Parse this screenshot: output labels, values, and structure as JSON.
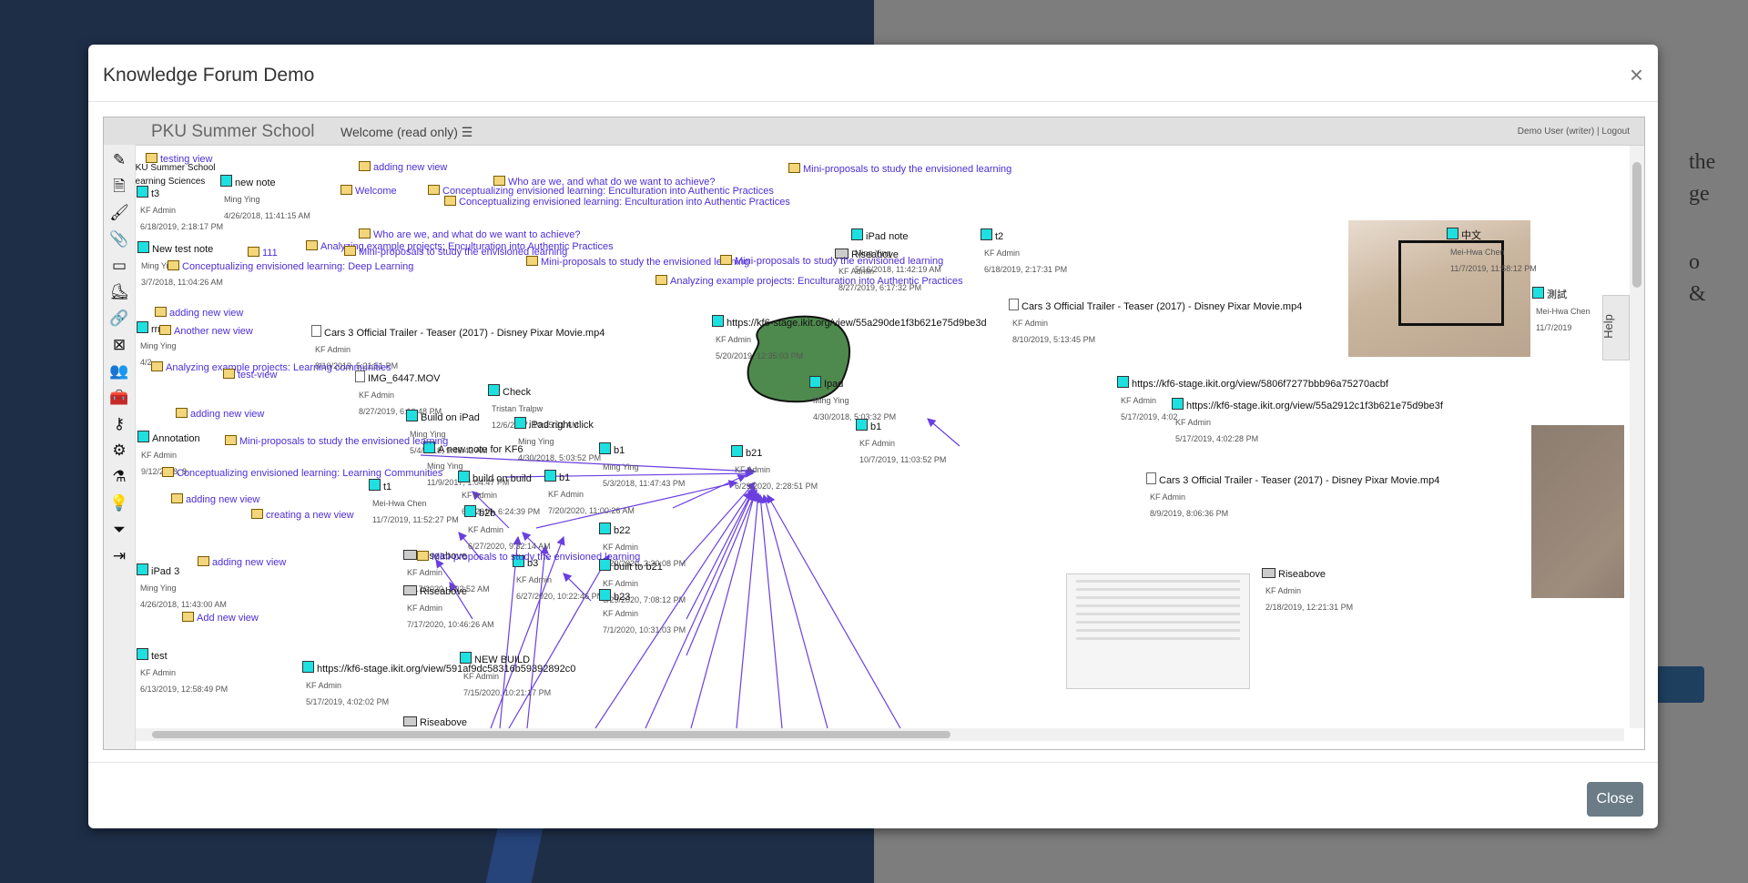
{
  "background": {
    "text_lines": [
      "the",
      "ge",
      "o",
      "&"
    ],
    "colors": {
      "left": "#1e2e47",
      "right": "#7d7d7d"
    }
  },
  "modal": {
    "title": "Knowledge Forum Demo",
    "close_x": "×",
    "close_button": "Close"
  },
  "kf": {
    "community": "PKU Summer School",
    "view_title": "Welcome (read only)",
    "view_menu_icon": "list-icon",
    "user": "Demo User (writer)",
    "separator": "|",
    "logout": "Logout",
    "help": "Help",
    "toolbar": [
      "pencil-icon",
      "note-icon",
      "brush-icon",
      "paperclip-icon",
      "window-icon",
      "shoe-icon",
      "link-icon",
      "image-icon",
      "users-icon",
      "toolbox-icon",
      "key-icon",
      "gear-icon",
      "flask-icon",
      "lightbulb-icon",
      "filter-icon",
      "exit-icon"
    ],
    "link_color": "#4d2ed6",
    "notes": [
      {
        "title": "t3",
        "author": "KF Admin",
        "date": "6/18/2019, 2:18:17 PM"
      },
      {
        "title": "new note",
        "author": "Ming Ying",
        "date": "4/26/2018, 11:41:15 AM"
      },
      {
        "title": "New test note",
        "author": "Ming Ying",
        "date": "3/7/2018, 11:04:26 AM"
      },
      {
        "title": "rrr",
        "author": "Ming Ying",
        "date": "4/2"
      },
      {
        "title": "Cars 3 Official Trailer - Teaser (2017) - Disney Pixar Movie.mp4",
        "author": "KF Admin",
        "date": "8/10/2019, 5:21:51 PM"
      },
      {
        "title": "IMG_6447.MOV",
        "author": "KF Admin",
        "date": "8/27/2019, 6:16:48 PM"
      },
      {
        "title": "Check",
        "author": "Tristan Tralpw",
        "date": "12/6/2017, 10:25:31 AM"
      },
      {
        "title": "Build on iPad",
        "author": "Ming Ying",
        "date": "5/4/2018, 9:46:42 AM"
      },
      {
        "title": "iPad right click",
        "author": "Ming Ying",
        "date": "4/30/2018, 5:03:52 PM"
      },
      {
        "title": "A new note for KF6",
        "author": "Ming Ying",
        "date": "11/9/2017, 1:04:47 PM"
      },
      {
        "title": "b1",
        "author": "Ming Ying",
        "date": "5/3/2018, 11:47:43 PM"
      },
      {
        "title": "Annotation",
        "author": "KF Admin",
        "date": "9/12/2018, 8"
      },
      {
        "title": "t1",
        "author": "Mei-Hwa Chen",
        "date": "11/7/2019, 11:52:27 PM"
      },
      {
        "title": "build on build",
        "author": "KF Admin",
        "date": "6/5/2019, 6:24:39 PM"
      },
      {
        "title": "b1",
        "author": "KF Admin",
        "date": "7/20/2020, 11:00:26 AM"
      },
      {
        "title": "b21",
        "author": "KF Admin",
        "date": "6/29/2020, 2:28:51 PM"
      },
      {
        "title": "b2b",
        "author": "KF Admin",
        "date": "6/27/2020, 9:32:14 AM"
      },
      {
        "title": "b22",
        "author": "KF Admin",
        "date": "6/29/2020, 2:30:08 PM"
      },
      {
        "title": "Riseabove",
        "author": "KF Admin",
        "date": "7/17/2020, 1:02:52 AM"
      },
      {
        "title": "b3",
        "author": "KF Admin",
        "date": "6/27/2020, 10:22:46 PM"
      },
      {
        "title": "built to b21",
        "author": "KF Admin",
        "date": "6/29/2020, 7:08:12 PM"
      },
      {
        "title": "iPad 3",
        "author": "Ming Ying",
        "date": "4/26/2018, 11:43:00 AM"
      },
      {
        "title": "Riseabove",
        "author": "KF Admin",
        "date": "7/17/2020, 10:46:26 AM"
      },
      {
        "title": "b23",
        "author": "KF Admin",
        "date": "7/1/2020, 10:31:03 PM"
      },
      {
        "title": "test",
        "author": "KF Admin",
        "date": "6/13/2019, 12:58:49 PM"
      },
      {
        "title": "https://kf6-stage.ikit.org/view/591af9dc58316b59392892c0",
        "author": "KF Admin",
        "date": "5/17/2019, 4:02:02 PM"
      },
      {
        "title": "NEW BUILD",
        "author": "KF Admin",
        "date": "7/15/2020, 10:21:17 PM"
      },
      {
        "title": "Riseabove",
        "author": "",
        "date": ""
      },
      {
        "title": "iPad note",
        "author": "Ming Ying",
        "date": "5/16/2018, 11:42:19 AM"
      },
      {
        "title": "Riseabove",
        "author": "KF Admin",
        "date": "8/27/2019, 6:17:32 PM"
      },
      {
        "title": "t2",
        "author": "KF Admin",
        "date": "6/18/2019, 2:17:31 PM"
      },
      {
        "title": "https://kf6-stage.ikit.org/view/55a290de1f3b621e75d9be3d",
        "author": "KF Admin",
        "date": "5/20/2019, 12:35:03 PM"
      },
      {
        "title": "Cars 3 Official Trailer - Teaser (2017) - Disney Pixar Movie.mp4",
        "author": "KF Admin",
        "date": "8/10/2019, 5:13:45 PM"
      },
      {
        "title": "Ipad",
        "author": "Ming Ying",
        "date": "4/30/2018, 5:03:32 PM"
      },
      {
        "title": "b1",
        "author": "KF Admin",
        "date": "10/7/2019, 11:03:52 PM"
      },
      {
        "title": "中文",
        "author": "Mei-Hwa Chen",
        "date": "11/7/2019, 11:58:12 PM"
      },
      {
        "title": "測試",
        "author": "Mei-Hwa Chen",
        "date": "11/7/2019"
      },
      {
        "title": "https://kf6-stage.ikit.org/view/5806f7277bbb96a75270acbf",
        "author": "KF Admin",
        "date": "5/17/2019, 4:02"
      },
      {
        "title": "https://kf6-stage.ikit.org/view/55a2912c1f3b621e75d9be3f",
        "author": "KF Admin",
        "date": "5/17/2019, 4:02:28 PM"
      },
      {
        "title": "Cars 3 Official Trailer - Teaser (2017) - Disney Pixar Movie.mp4",
        "author": "KF Admin",
        "date": "8/9/2019, 8:06:36 PM"
      },
      {
        "title": "Riseabove",
        "author": "KF Admin",
        "date": "2/18/2019, 12:21:31 PM"
      }
    ],
    "views": [
      "testing view",
      "PKU Summer School",
      "Learning Sciences",
      "adding new view",
      "Welcome",
      "Who are we, and what do we want to achieve?",
      "Conceptualizing envisioned learning: Enculturation into Authentic Practices",
      "Conceptualizing envisioned learning: Enculturation into Authentic Practices",
      "Mini-proposals to study the envisioned learning",
      "Who are we, and what do we want to achieve?",
      "111",
      "Analyzing example projects: Enculturation into Authentic Practices",
      "Mini-proposals to study the envisioned learning",
      "Conceptualizing envisioned learning: Deep Learning",
      "Mini-proposals to study the envisioned learning",
      "Mini-proposals to study the envisioned learning",
      "Analyzing example projects: Enculturation into Authentic Practices",
      "adding new view",
      "Another new view",
      "Analyzing example projects: Learning communities",
      "test-view",
      "adding new view",
      "Mini-proposals to study the envisioned learning",
      "Conceptualizing envisioned learning: Learning Communities",
      "adding new view",
      "creating a new view",
      "Mini-proposals to study the envisioned learning",
      "adding new view",
      "Add new view"
    ]
  }
}
